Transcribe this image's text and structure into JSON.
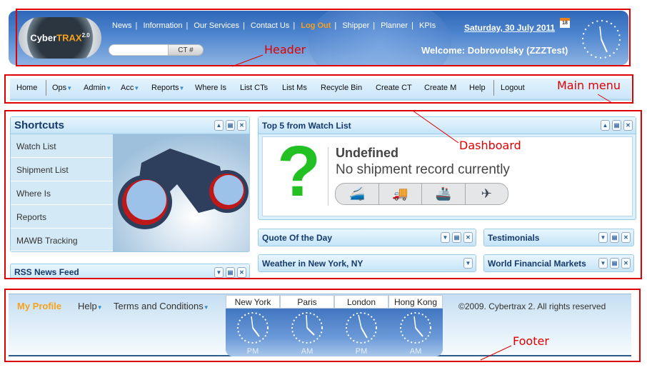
{
  "header": {
    "logo_text": "CyberTRAX 2.0",
    "nav": [
      "News",
      "Information",
      "Our Services",
      "Contact Us",
      "Log Out",
      "Shipper",
      "Planner",
      "KPIs"
    ],
    "search_placeholder": "",
    "search_button": "CT #",
    "date": "Saturday, 30 July 2011",
    "calendar_day": "18",
    "welcome": "Welcome: Dobrovolsky (ZZZTest)"
  },
  "main_menu": {
    "items": [
      "Home",
      "Ops",
      "Admin",
      "Acc",
      "Reports",
      "Where Is",
      "List CTs",
      "List Ms",
      "Recycle Bin",
      "Create CT",
      "Create M",
      "Help",
      "Logout"
    ]
  },
  "shortcuts": {
    "title": "Shortcuts",
    "items": [
      "Watch List",
      "Shipment List",
      "Where Is",
      "Reports",
      "MAWB Tracking"
    ]
  },
  "rss": {
    "title": "RSS News Feed"
  },
  "watchlist": {
    "title": "Top 5 from Watch List",
    "status": "Undefined",
    "message": "No shipment record currently",
    "modes": [
      "train-icon",
      "truck-icon",
      "ship-icon",
      "plane-icon"
    ]
  },
  "widgets": {
    "quote": "Quote Of the Day",
    "testimonials": "Testimonials",
    "weather": "Weather in New York, NY",
    "markets": "World Financial Markets"
  },
  "footer": {
    "my_profile": "My Profile",
    "help": "Help",
    "terms": "Terms and Conditions",
    "clocks": [
      {
        "city": "New York",
        "ampm": "PM"
      },
      {
        "city": "Paris",
        "ampm": "AM"
      },
      {
        "city": "London",
        "ampm": "PM"
      },
      {
        "city": "Hong Kong",
        "ampm": "AM"
      }
    ],
    "copyright": "©2009. Cybertrax 2. All rights reserved"
  },
  "annotations": {
    "header": "Header",
    "main_menu": "Main menu",
    "dashboard": "Dashboard",
    "footer": "Footer"
  },
  "colors": {
    "accent_orange": "#f7a21c",
    "header_blue": "#2f68b8",
    "annotation_red": "#e00000"
  }
}
